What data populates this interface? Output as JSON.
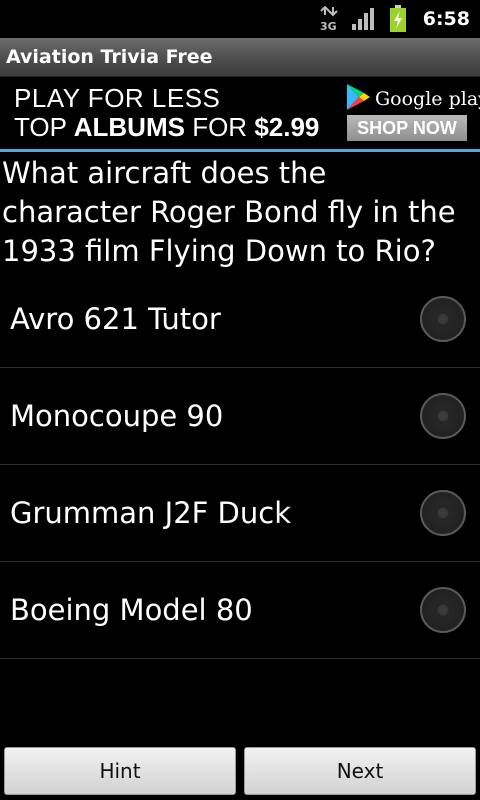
{
  "status_bar": {
    "network_label": "3G",
    "time": "6:58",
    "icons": [
      "network-3g-icon",
      "signal-icon",
      "battery-charging-icon"
    ]
  },
  "app": {
    "title": "Aviation Trivia Free"
  },
  "ad": {
    "line1": "PLAY FOR LESS",
    "line2_prefix": "TOP",
    "line2_bold": "ALBUMS",
    "line2_mid": "FOR",
    "line2_price": "$2.99",
    "store_name": "Google play",
    "cta": "SHOP NOW",
    "accent_color": "#4fa6d8"
  },
  "question": "What aircraft does the character Roger Bond fly in the 1933 film Flying Down to Rio?",
  "options": [
    {
      "label": "Avro 621 Tutor"
    },
    {
      "label": "Monocoupe 90"
    },
    {
      "label": "Grumman J2F Duck"
    },
    {
      "label": "Boeing Model 80"
    }
  ],
  "buttons": {
    "hint": "Hint",
    "next": "Next"
  }
}
